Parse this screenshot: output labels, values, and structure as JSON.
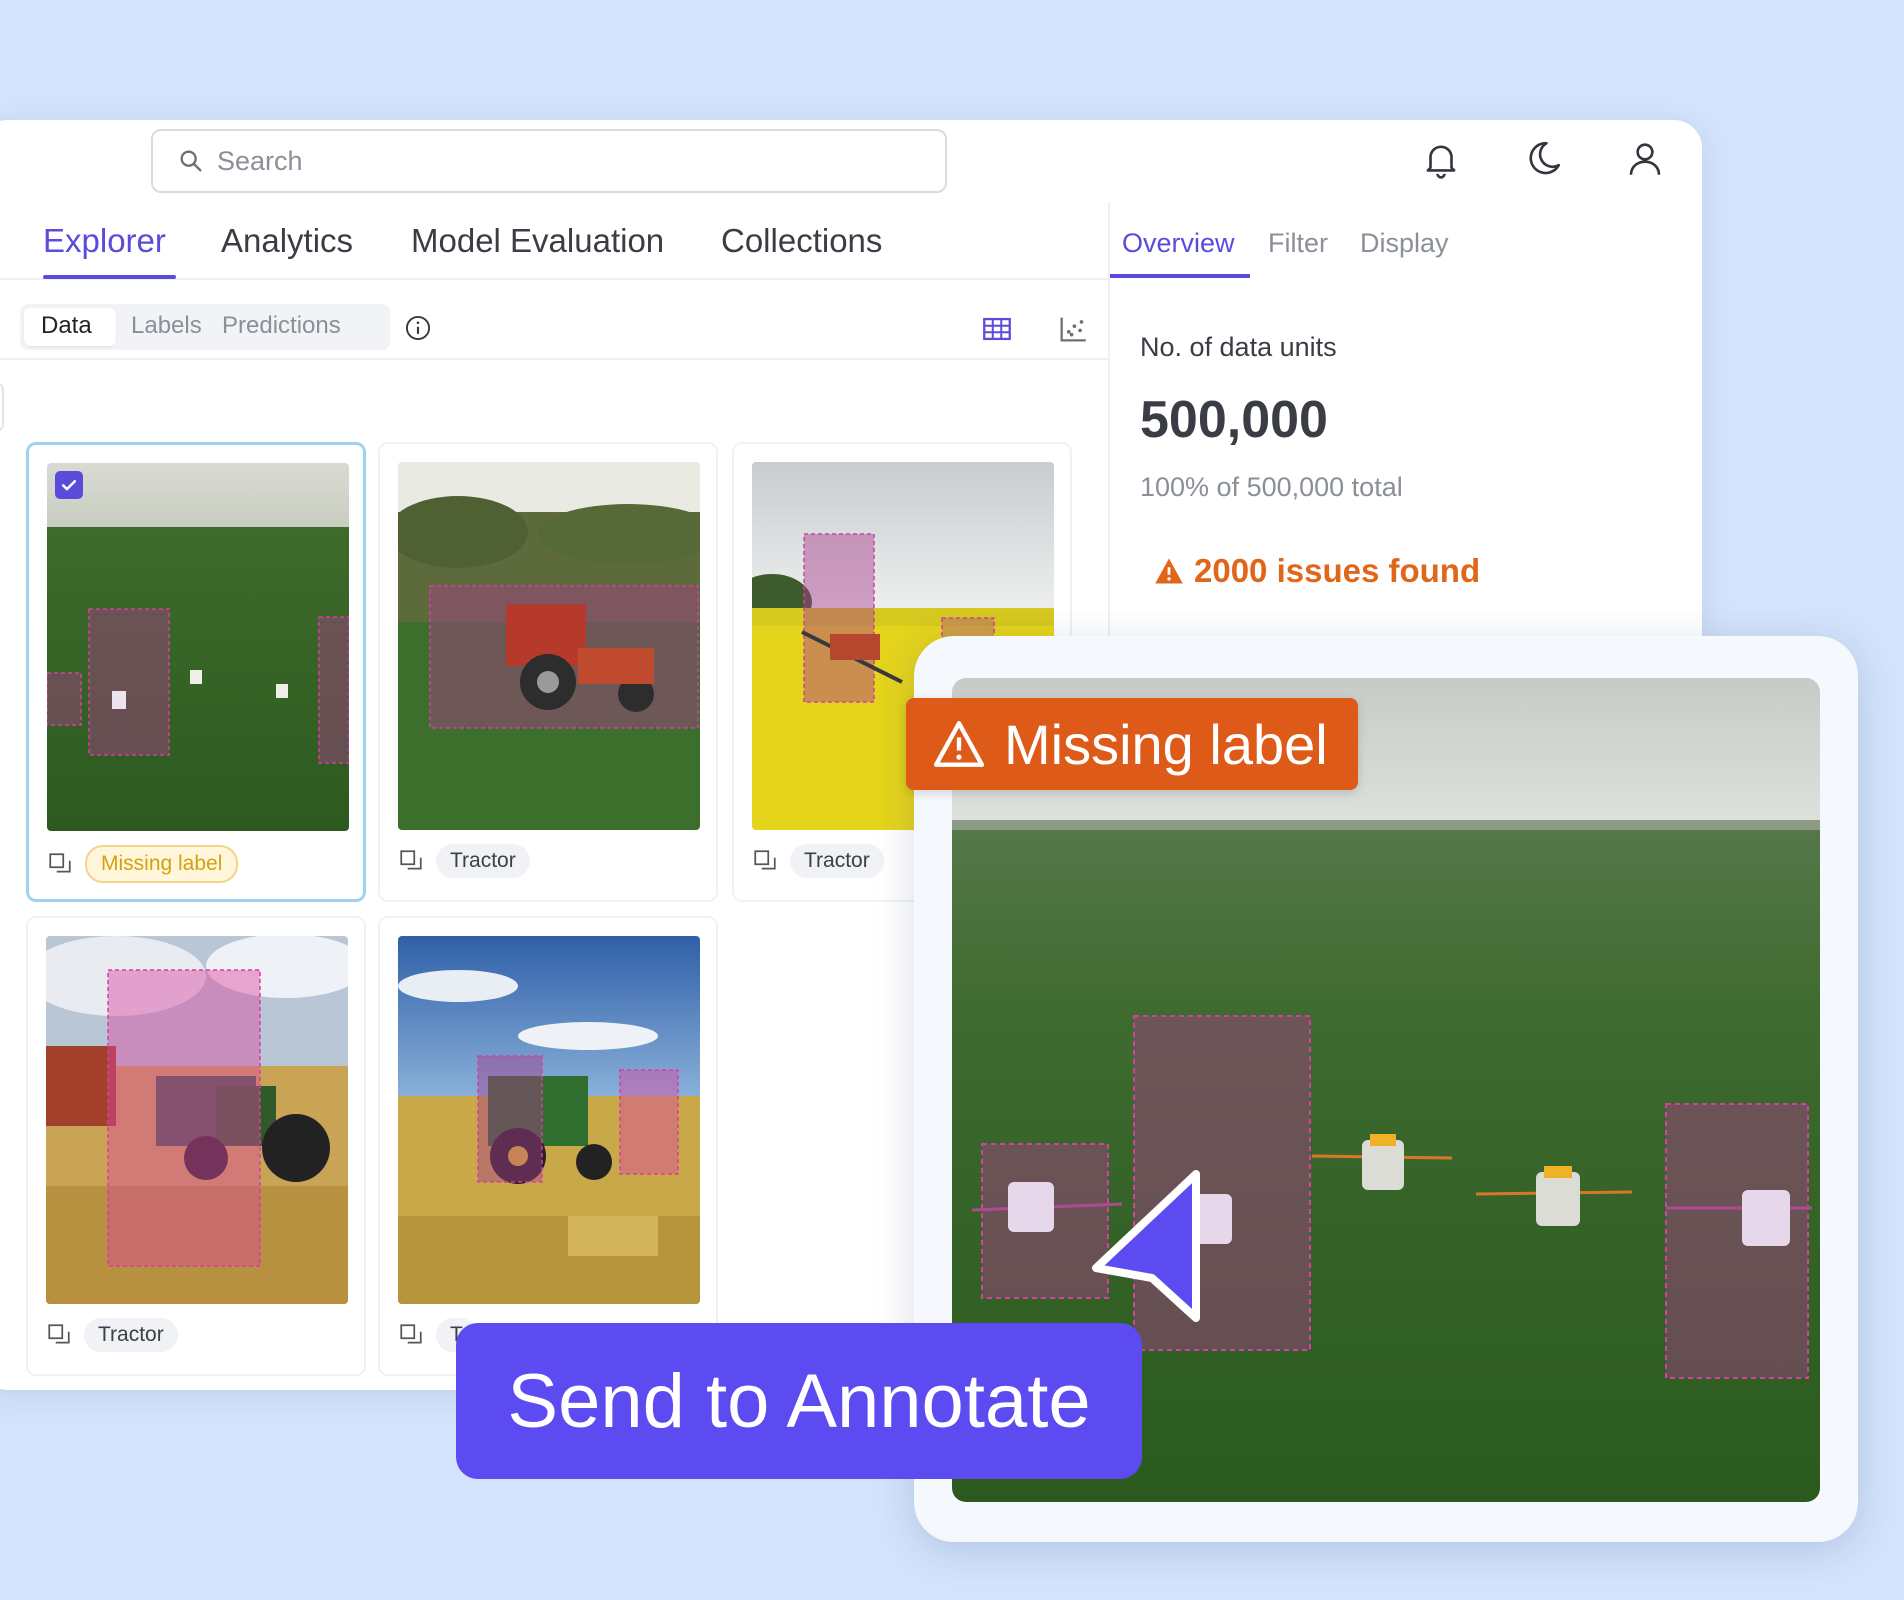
{
  "search": {
    "placeholder": "Search"
  },
  "header_icons": [
    "bell-icon",
    "moon-icon",
    "user-icon"
  ],
  "nav": {
    "tabs": [
      {
        "label": "Explorer",
        "active": true
      },
      {
        "label": "Analytics",
        "active": false
      },
      {
        "label": "Model Evaluation",
        "active": false
      },
      {
        "label": "Collections",
        "active": false
      }
    ]
  },
  "subnav": {
    "segments": [
      {
        "label": "Data",
        "active": true
      },
      {
        "label": "Labels",
        "active": false
      },
      {
        "label": "Predictions",
        "active": false
      }
    ],
    "view_icons": [
      "grid-view-icon",
      "scatter-view-icon"
    ]
  },
  "cards": [
    {
      "tag": "Missing label",
      "tag_type": "warning",
      "selected": true
    },
    {
      "tag": "Tractor",
      "tag_type": "default",
      "selected": false
    },
    {
      "tag": "Tractor",
      "tag_type": "default",
      "selected": false
    },
    {
      "tag": "Tractor",
      "tag_type": "default",
      "selected": false
    },
    {
      "tag": "T",
      "tag_type": "default",
      "selected": false
    }
  ],
  "panel": {
    "tabs": [
      {
        "label": "Overview",
        "active": true
      },
      {
        "label": "Filter",
        "active": false
      },
      {
        "label": "Display",
        "active": false
      }
    ],
    "label": "No. of data units",
    "value": "500,000",
    "sub": "100% of 500,000 total",
    "issues": "2000 issues found"
  },
  "overlay": {
    "banner": "Missing label",
    "action": "Send to Annotate"
  },
  "colors": {
    "accent": "#5b4bdb",
    "button": "#5b4bf0",
    "warning": "#dd5a18",
    "background": "#d3e3fb"
  }
}
